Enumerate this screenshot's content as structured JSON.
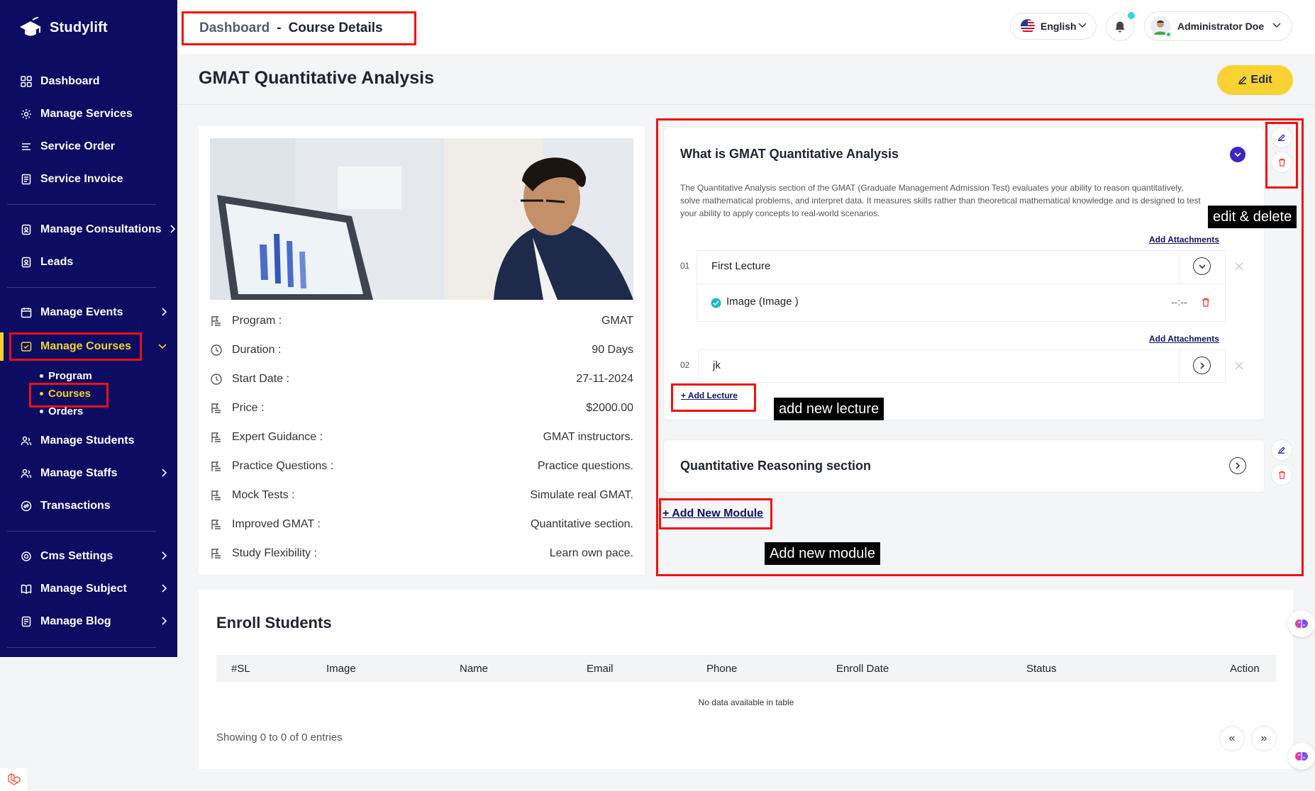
{
  "app": {
    "name": "Studylift"
  },
  "sidebar": {
    "items": [
      {
        "label": "Dashboard"
      },
      {
        "label": "Manage Services"
      },
      {
        "label": "Service Order"
      },
      {
        "label": "Service Invoice"
      },
      {
        "label": "Manage Consultations"
      },
      {
        "label": "Leads"
      },
      {
        "label": "Manage Events"
      },
      {
        "label": "Manage Courses"
      },
      {
        "label": "Manage Students"
      },
      {
        "label": "Manage Staffs"
      },
      {
        "label": "Transactions"
      },
      {
        "label": "Cms Settings"
      },
      {
        "label": "Manage Subject"
      },
      {
        "label": "Manage Blog"
      }
    ],
    "courses_sub": [
      {
        "label": "Program"
      },
      {
        "label": "Courses"
      },
      {
        "label": "Orders"
      }
    ]
  },
  "header": {
    "breadcrumb_root": "Dashboard",
    "breadcrumb_sep": "-",
    "breadcrumb_current": "Course Details",
    "language": "English",
    "user_name": "Administrator Doe"
  },
  "page": {
    "title": "GMAT Quantitative Analysis",
    "edit_label": "Edit"
  },
  "course_info": [
    {
      "label": "Program :",
      "value": "GMAT"
    },
    {
      "label": "Duration :",
      "value": "90 Days"
    },
    {
      "label": "Start Date :",
      "value": "27-11-2024"
    },
    {
      "label": "Price :",
      "value": "$2000.00"
    },
    {
      "label": "Expert Guidance :",
      "value": "GMAT instructors."
    },
    {
      "label": "Practice Questions :",
      "value": "Practice questions."
    },
    {
      "label": "Mock Tests :",
      "value": "Simulate real GMAT."
    },
    {
      "label": "Improved GMAT :",
      "value": "Quantitative section."
    },
    {
      "label": "Study Flexibility :",
      "value": "Learn own pace."
    }
  ],
  "modules": [
    {
      "title": "What is GMAT Quantitative Analysis",
      "description": "The Quantitative Analysis section of the GMAT (Graduate Management Admission Test) evaluates your ability to reason quantitatively, solve mathematical problems, and interpret data. It measures skills rather than theoretical mathematical knowledge and is designed to test your ability to apply concepts to real-world scenarios.",
      "add_attachments": "Add Attachments",
      "lectures": [
        {
          "num": "01",
          "title": "First Lecture",
          "attachment": "Image (Image )",
          "duration": "--:--"
        },
        {
          "num": "02",
          "title": "jk"
        }
      ],
      "add_lecture": "+ Add Lecture"
    },
    {
      "title": "Quantitative Reasoning section"
    }
  ],
  "add_module": "+ Add New Module",
  "callouts": {
    "edit_delete": "edit & delete",
    "new_lecture": "add new lecture",
    "new_module": "Add new module"
  },
  "enroll": {
    "title": "Enroll Students",
    "columns": [
      "#SL",
      "Image",
      "Name",
      "Email",
      "Phone",
      "Enroll Date",
      "Status",
      "Action"
    ],
    "empty": "No data available in table",
    "showing": "Showing 0 to 0 of 0 entries",
    "prev": "«",
    "next": "»"
  },
  "colors": {
    "sidebar_bg": "#0c0c63",
    "accent_yellow": "#f7d232",
    "highlight_red": "#ee1111",
    "toggle_purple": "#3a26c2"
  }
}
